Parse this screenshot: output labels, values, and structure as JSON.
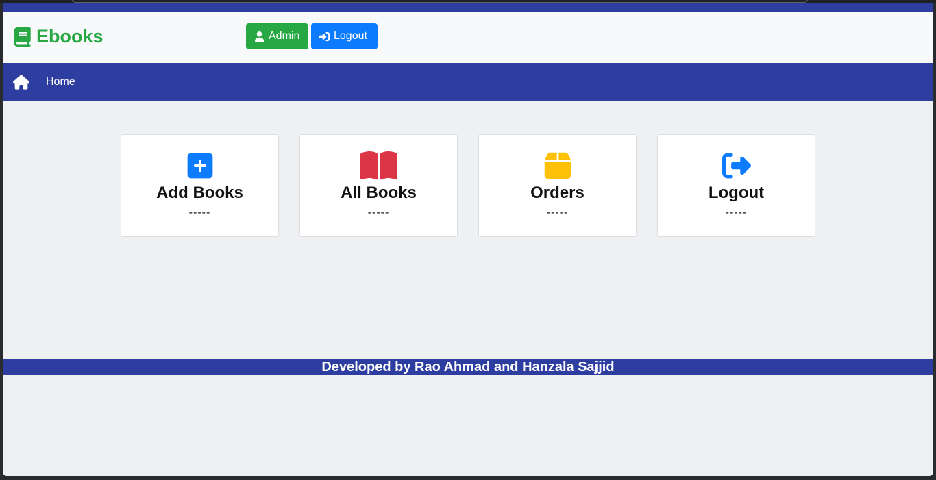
{
  "brand": {
    "name": "Ebooks",
    "icon": "book-icon",
    "color": "#28a745"
  },
  "header": {
    "admin_label": "Admin",
    "logout_label": "Logout",
    "admin_color": "#28a745",
    "logout_color": "#0d7bfd"
  },
  "nav": {
    "home_label": "Home",
    "home_icon": "home-icon",
    "bg_color": "#2e3ea0"
  },
  "cards": [
    {
      "title": "Add Books",
      "subtitle": "-----",
      "icon": "plus-square-icon",
      "color": "#0d7bfd"
    },
    {
      "title": "All Books",
      "subtitle": "-----",
      "icon": "open-book-icon",
      "color": "#dc3545"
    },
    {
      "title": "Orders",
      "subtitle": "-----",
      "icon": "box-icon",
      "color": "#ffc107"
    },
    {
      "title": "Logout",
      "subtitle": "-----",
      "icon": "sign-out-icon",
      "color": "#0d7bfd"
    }
  ],
  "footer": {
    "text": "Developed by Rao Ahmad and Hanzala Sajjid"
  }
}
